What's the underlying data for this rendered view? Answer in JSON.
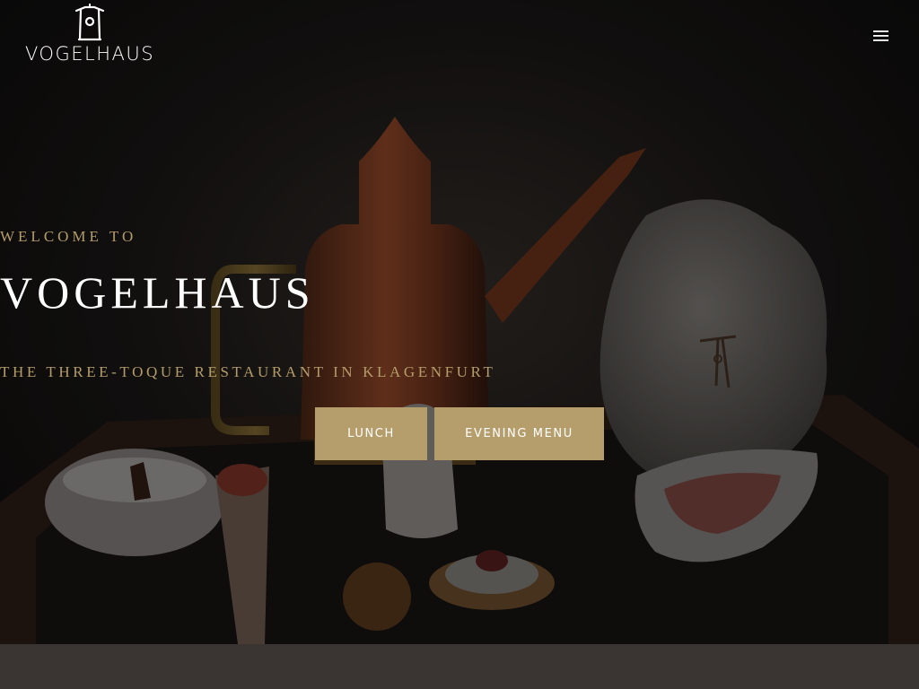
{
  "header": {
    "logo_text": "VOGELHAUS",
    "menu_icon": "hamburger-menu-icon"
  },
  "hero": {
    "kicker": "WELCOME TO",
    "title": "VOGELHAUS",
    "subtitle": "THE THREE-TOQUE RESTAURANT IN KLAGENFURT",
    "buttons": [
      {
        "label": "LUNCH"
      },
      {
        "label": "EVENING MENU"
      }
    ]
  },
  "colors": {
    "accent_gold": "#b69e6c",
    "hero_dark": "#151312",
    "footer_band": "#3a3533",
    "text_white": "#ffffff"
  }
}
